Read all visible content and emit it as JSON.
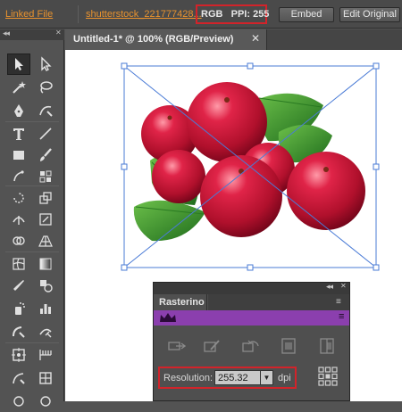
{
  "control_bar": {
    "linked_file": "Linked File",
    "file_name": "shutterstock_221777428...",
    "color_mode": "RGB",
    "ppi": "PPI: 255",
    "embed_label": "Embed",
    "edit_original_label": "Edit Original"
  },
  "tools_panel": {
    "collapse_glyph": "◂◂",
    "close_glyph": "✕",
    "tools": [
      "selection",
      "direct-selection",
      "magic-wand",
      "lasso",
      "pen",
      "curvature",
      "type",
      "line-segment",
      "rectangle",
      "paintbrush",
      "shaper",
      "pencil",
      "eraser",
      "rotate",
      "scale",
      "width",
      "free-transform",
      "shape-builder",
      "perspective-grid",
      "mesh",
      "gradient",
      "eyedropper",
      "blend",
      "symbol-sprayer",
      "column-graph",
      "artboard",
      "slice",
      "hand",
      "zoom",
      "fill-stroke"
    ]
  },
  "document": {
    "tab_title": "Untitled-1* @ 100% (RGB/Preview)",
    "close_glyph": "✕"
  },
  "rasterino": {
    "title": "Rasterino",
    "collapse_glyph": "◂◂",
    "close_glyph": "✕",
    "menu_glyph": "≡",
    "header_menu_glyph": "≡",
    "header_icon": "crown-icon",
    "header_color": "#8b3fae",
    "buttons": [
      "relink-icon",
      "edit-raster-icon",
      "rotate-raster-icon",
      "crop-raster-icon",
      "clip-raster-icon"
    ],
    "resolution_label": "Resolution:",
    "resolution_value": "255.32",
    "resolution_unit": "dpi",
    "dropdown_glyph": "▼",
    "grid_icon": "grid-icon"
  },
  "colors": {
    "accent_orange": "#e8922e",
    "highlight_red": "#d2232a",
    "selection_blue": "#4a7bd6",
    "rasterino_purple": "#8b3fae"
  }
}
